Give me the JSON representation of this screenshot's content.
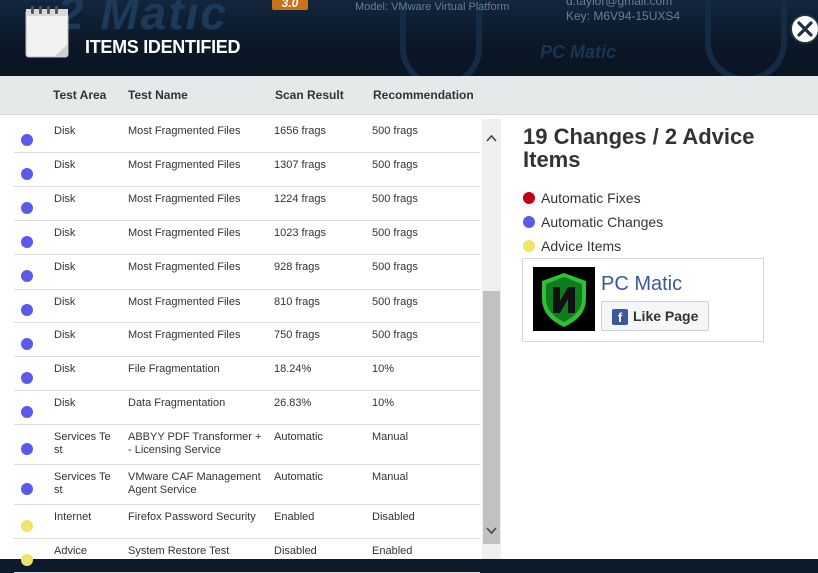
{
  "window": {
    "title": "ITEMS IDENTIFIED",
    "banner_logo_partial": "2 Matic",
    "version_badge": "3.0",
    "model_text": "Model: VMware Virtual Platform",
    "email_partial": "d.taylor@gmail.com",
    "key_partial": "Key: M6V94-15UXS4",
    "banner_watermark": "PC Matic"
  },
  "table": {
    "headers": {
      "test_area": "Test Area",
      "test_name": "Test Name",
      "scan_result": "Scan Result",
      "recommendation": "Recommendation"
    },
    "rows": [
      {
        "type": "automatic-change",
        "area": "Disk",
        "name": "Most Fragmented Files",
        "result": "1656 frags",
        "rec": "500 frags"
      },
      {
        "type": "automatic-change",
        "area": "Disk",
        "name": "Most Fragmented Files",
        "result": "1307 frags",
        "rec": "500 frags"
      },
      {
        "type": "automatic-change",
        "area": "Disk",
        "name": "Most Fragmented Files",
        "result": "1224 frags",
        "rec": "500 frags"
      },
      {
        "type": "automatic-change",
        "area": "Disk",
        "name": "Most Fragmented Files",
        "result": "1023 frags",
        "rec": "500 frags"
      },
      {
        "type": "automatic-change",
        "area": "Disk",
        "name": "Most Fragmented Files",
        "result": "928 frags",
        "rec": "500 frags"
      },
      {
        "type": "automatic-change",
        "area": "Disk",
        "name": "Most Fragmented Files",
        "result": "810 frags",
        "rec": "500 frags"
      },
      {
        "type": "automatic-change",
        "area": "Disk",
        "name": "Most Fragmented Files",
        "result": "750 frags",
        "rec": "500 frags"
      },
      {
        "type": "automatic-change",
        "area": "Disk",
        "name": "File Fragmentation",
        "result": "18.24%",
        "rec": "10%"
      },
      {
        "type": "automatic-change",
        "area": "Disk",
        "name": "Data Fragmentation",
        "result": "26.83%",
        "rec": "10%"
      },
      {
        "type": "automatic-change",
        "area": "Services Te st",
        "name": "ABBYY PDF Transformer + - Licensing Service",
        "result": "Automatic",
        "rec": "Manual"
      },
      {
        "type": "automatic-change",
        "area": "Services Te st",
        "name": "VMware CAF Management Agent Service",
        "result": "Automatic",
        "rec": "Manual"
      },
      {
        "type": "advice",
        "area": "Internet",
        "name": "Firefox Password Security",
        "result": "Enabled",
        "rec": "Disabled"
      },
      {
        "type": "advice",
        "area": "Advice",
        "name": "System Restore Test",
        "result": "Disabled",
        "rec": "Enabled"
      }
    ]
  },
  "summary": {
    "headline": "19 Changes / 2 Advice Items",
    "legend": [
      {
        "label": "Automatic Fixes",
        "color": "#c0001a"
      },
      {
        "label": "Automatic Changes",
        "color": "#5b5bea"
      },
      {
        "label": "Advice Items",
        "color": "#f0e36a"
      }
    ]
  },
  "facebook": {
    "page_name": "PC Matic",
    "like_label": "Like Page",
    "like_icon_glyph": "f"
  },
  "colors": {
    "automatic-change": "#5b5bea",
    "advice": "#f0e36a",
    "accent_blue": "#3b5998"
  },
  "icons": [
    "notepad-icon",
    "close-icon",
    "scroll-up-icon",
    "scroll-down-icon",
    "pc-matic-shield-icon",
    "facebook-icon"
  ]
}
